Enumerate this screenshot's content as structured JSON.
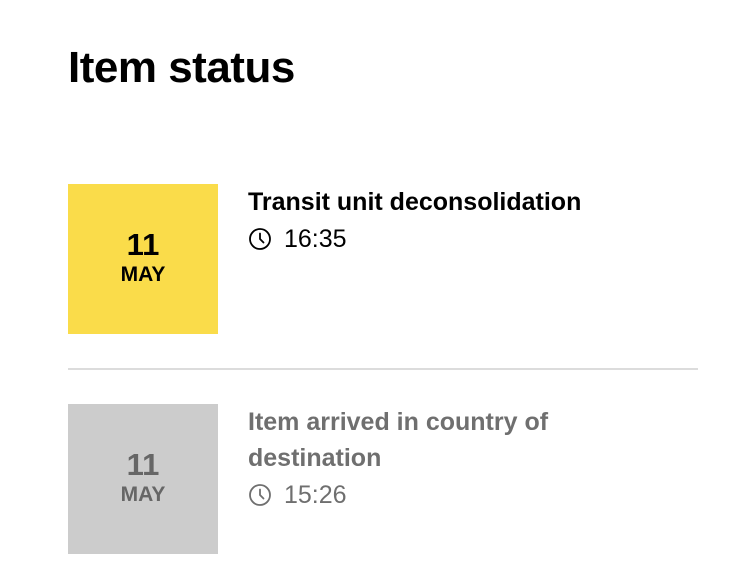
{
  "page": {
    "title": "Item status"
  },
  "status_items": [
    {
      "day": "11",
      "month": "MAY",
      "title": "Transit unit deconsolidation",
      "time": "16:35",
      "state": "current",
      "accent_color": "#fadc4a"
    },
    {
      "day": "11",
      "month": "MAY",
      "title": "Item arrived in country of destination",
      "time": "15:26",
      "state": "past",
      "accent_color": "#cccccc"
    }
  ],
  "icons": {
    "time": "clock-icon"
  }
}
